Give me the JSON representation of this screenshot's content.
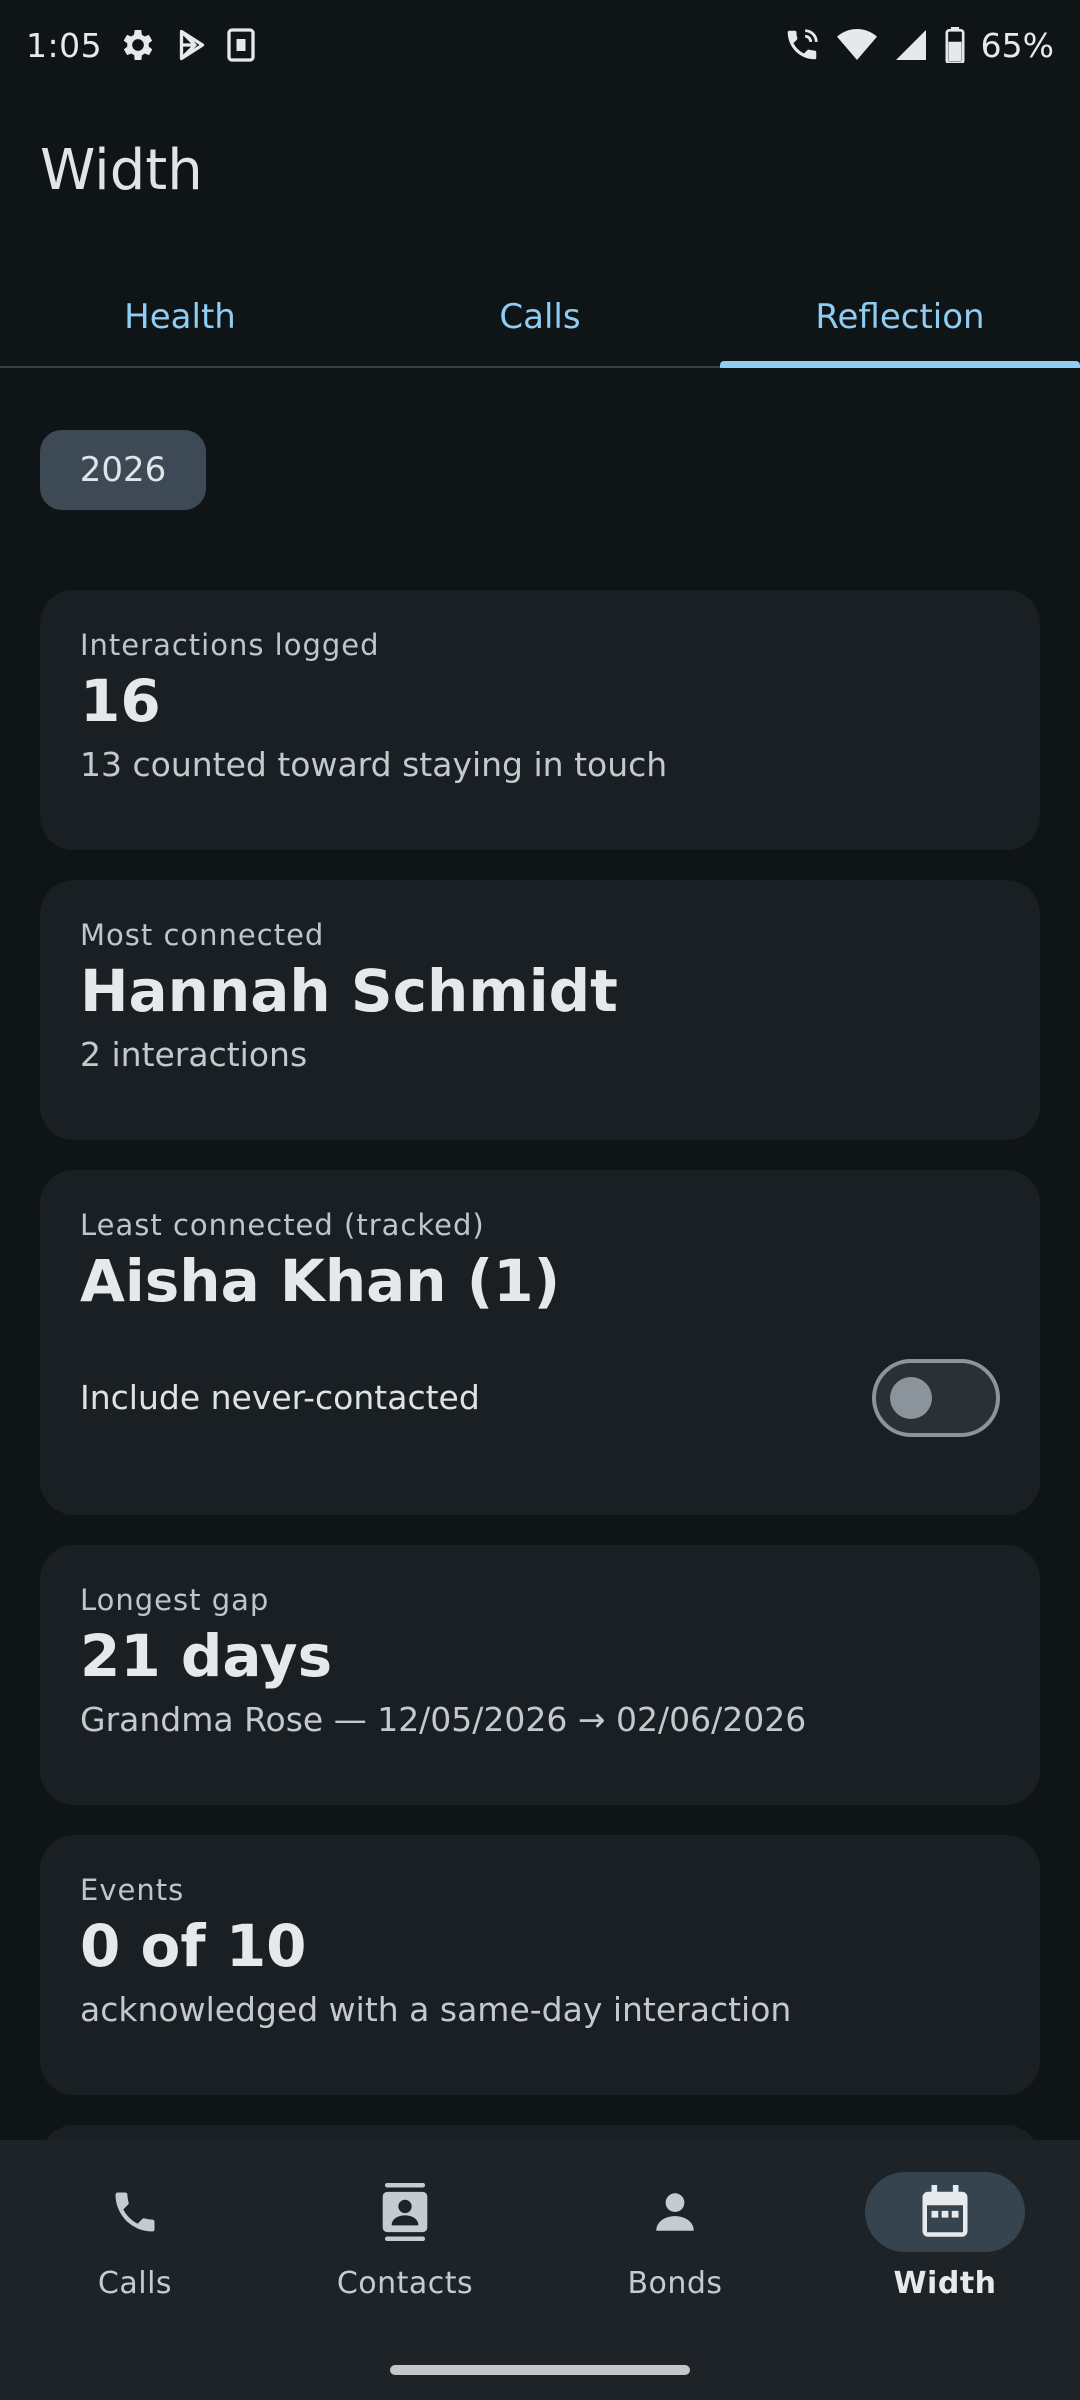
{
  "status_bar": {
    "time": "1:05",
    "battery": "65%",
    "icons_left": [
      "settings-icon",
      "play-store-icon",
      "sim-card-icon"
    ],
    "icons_right": [
      "wifi-calling-icon",
      "wifi-icon",
      "signal-icon",
      "battery-icon"
    ]
  },
  "app": {
    "title": "Width"
  },
  "tabs": [
    {
      "label": "Health",
      "active": false
    },
    {
      "label": "Calls",
      "active": false
    },
    {
      "label": "Reflection",
      "active": true
    }
  ],
  "year_chip": {
    "label": "2026"
  },
  "cards": {
    "interactions": {
      "label": "Interactions logged",
      "value": "16",
      "sub": "13 counted toward staying in touch"
    },
    "most_connected": {
      "label": "Most connected",
      "value": "Hannah Schmidt",
      "sub": "2 interactions"
    },
    "least_connected": {
      "label": "Least connected (tracked)",
      "value": "Aisha Khan (1)",
      "toggle_label": "Include never-contacted",
      "toggle_on": false
    },
    "longest_gap": {
      "label": "Longest gap",
      "value": "21 days",
      "sub": "Grandma Rose — 12/05/2026 → 02/06/2026"
    },
    "events": {
      "label": "Events",
      "value": "0 of 10",
      "sub": "acknowledged with a same-day interaction"
    }
  },
  "bottom_nav": [
    {
      "label": "Calls",
      "icon": "phone-icon",
      "active": false
    },
    {
      "label": "Contacts",
      "icon": "contacts-icon",
      "active": false
    },
    {
      "label": "Bonds",
      "icon": "person-icon",
      "active": false
    },
    {
      "label": "Width",
      "icon": "calendar-icon",
      "active": true
    }
  ],
  "colors": {
    "background": "#0f1417",
    "card": "#1a1f23",
    "accent": "#8fcdf2",
    "chip": "#3d4a55",
    "nav": "#1d2327"
  }
}
